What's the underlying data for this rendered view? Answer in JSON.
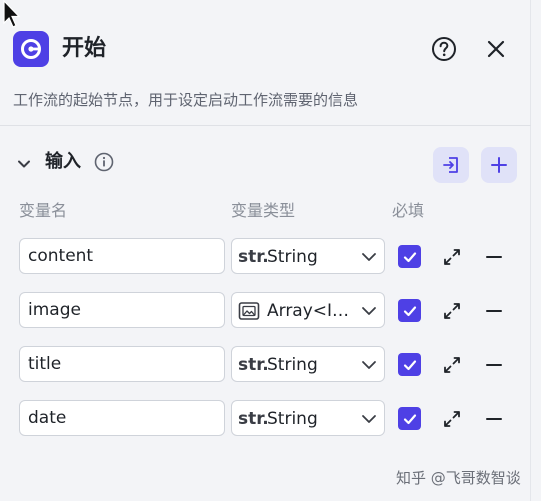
{
  "node": {
    "title": "开始",
    "description": "工作流的起始节点，用于设定启动工作流需要的信息"
  },
  "section": {
    "label": "输入"
  },
  "columns": {
    "name": "变量名",
    "type": "变量类型",
    "required": "必填"
  },
  "variables": [
    {
      "name": "content",
      "type": "String",
      "type_icon": "str-icon",
      "type_tag": "str.",
      "required": true
    },
    {
      "name": "image",
      "type": "Array<I…",
      "type_icon": "image-icon",
      "type_tag": "",
      "required": true
    },
    {
      "name": "title",
      "type": "String",
      "type_icon": "str-icon",
      "type_tag": "str.",
      "required": true
    },
    {
      "name": "date",
      "type": "String",
      "type_icon": "str-icon",
      "type_tag": "str.",
      "required": true
    }
  ],
  "watermark": "知乎 @飞哥数智谈",
  "colors": {
    "accent": "#4e40e5",
    "accent_soft": "#e0e2f8",
    "background": "#f3f4f7"
  }
}
